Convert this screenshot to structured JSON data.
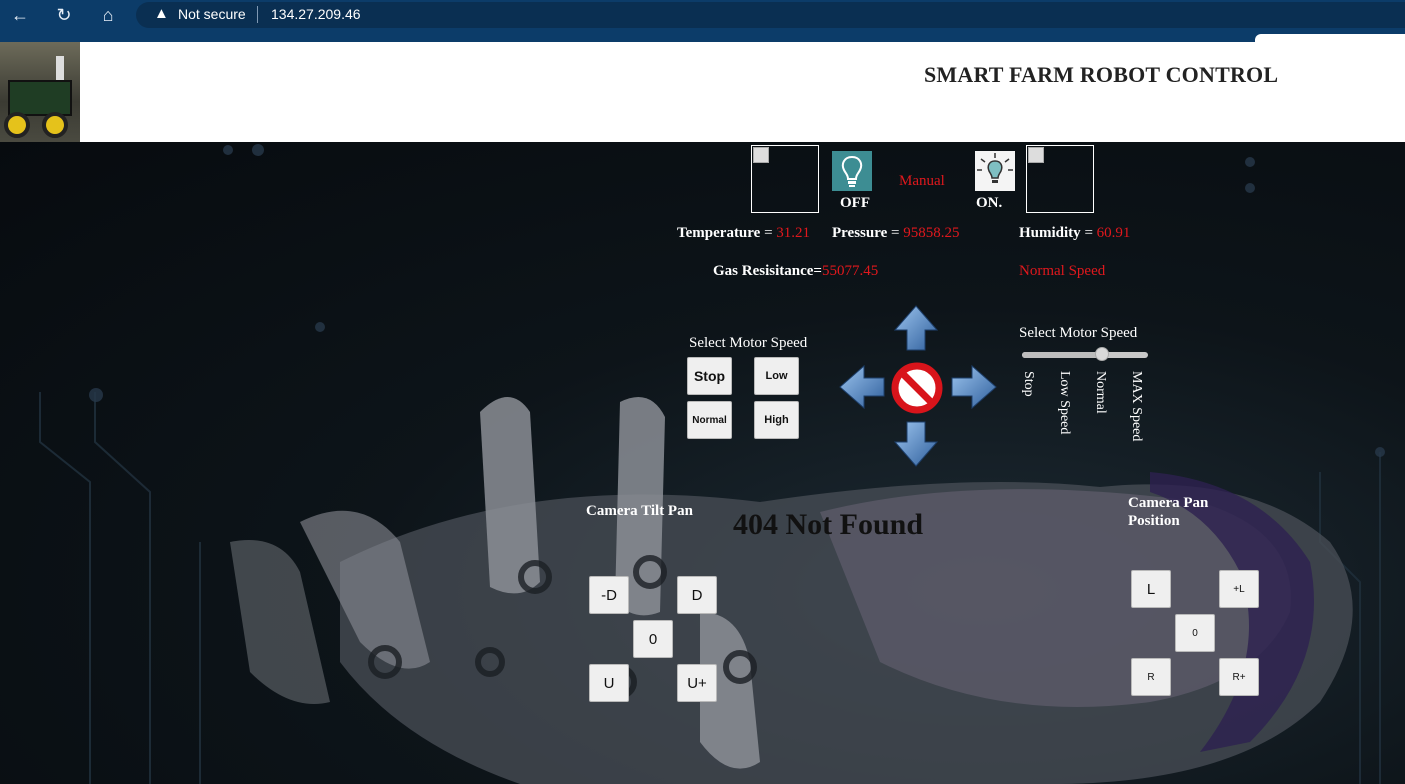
{
  "browser": {
    "security": "Not secure",
    "url": "134.27.209.46"
  },
  "header": {
    "title": "SMART FARM ROBOT CONTROL"
  },
  "status": {
    "light_off_label": "OFF",
    "mode": "Manual",
    "light_on_label": "ON."
  },
  "sensors": {
    "temperature_label": "Temperature",
    "temperature_value": "31.21",
    "pressure_label": "Pressure",
    "pressure_value": "95858.25",
    "humidity_label": "Humidity",
    "humidity_value": "60.91",
    "gas_label": "Gas Resisitance=",
    "gas_value": "55077.45",
    "speed_status": "Normal Speed",
    "equals": " = "
  },
  "motor_left": {
    "title": "Select Motor Speed",
    "buttons": [
      "Stop",
      "Low",
      "Normal",
      "High"
    ]
  },
  "motor_right": {
    "title": "Select Motor Speed",
    "slider_value_fraction": 0.65,
    "ticks": [
      "Stop",
      "Low Speed",
      "Normal",
      "MAX Speed"
    ]
  },
  "camera_tilt": {
    "title": "Camera Tilt Pan",
    "buttons": [
      "-D",
      "D",
      "0",
      "U",
      "U+"
    ]
  },
  "camera_pan": {
    "title_line1": "Camera Pan",
    "title_line2": "Position",
    "buttons": [
      "L",
      "+L",
      "0",
      "R",
      "R+"
    ]
  },
  "video": {
    "message": "404 Not Found"
  },
  "colors": {
    "accent_red": "#e0181d",
    "browser_bar": "#0c3c69",
    "arrow_blue": "#4a7fc0"
  },
  "icons": [
    "back-arrow-icon",
    "reload-icon",
    "home-icon",
    "warning-icon",
    "bulb-off-icon",
    "bulb-on-icon",
    "arrow-up-icon",
    "arrow-down-icon",
    "arrow-left-icon",
    "arrow-right-icon",
    "stop-icon"
  ]
}
